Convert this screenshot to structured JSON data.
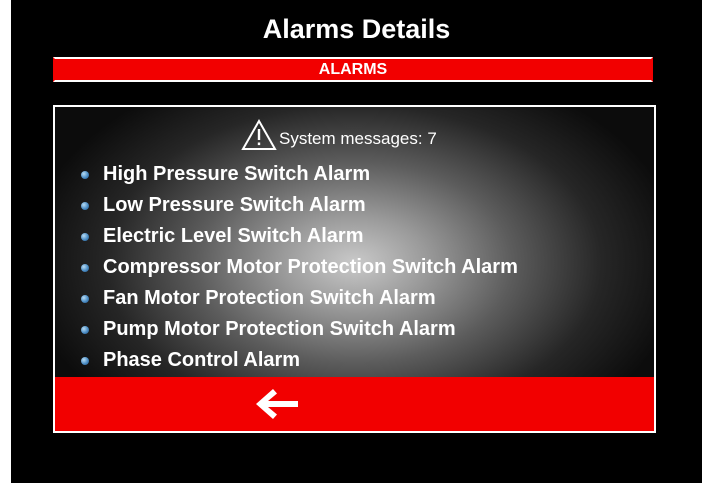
{
  "header": {
    "title": "Alarms Details"
  },
  "alarms_bar": {
    "label": "ALARMS"
  },
  "panel": {
    "messages_label": "System messages: 7",
    "warning_icon": "warning-triangle-icon",
    "alarms": [
      "High Pressure Switch Alarm",
      "Low Pressure Switch Alarm",
      "Electric Level Switch Alarm",
      "Compressor Motor Protection Switch Alarm",
      "Fan Motor Protection Switch Alarm",
      "Pump Motor Protection Switch Alarm",
      "Phase Control Alarm"
    ]
  },
  "footer": {
    "back_icon": "arrow-left-icon"
  },
  "colors": {
    "background": "#000000",
    "accent_red": "#f20000",
    "text": "#ffffff",
    "bullet_blue": "#4a8cc4"
  }
}
